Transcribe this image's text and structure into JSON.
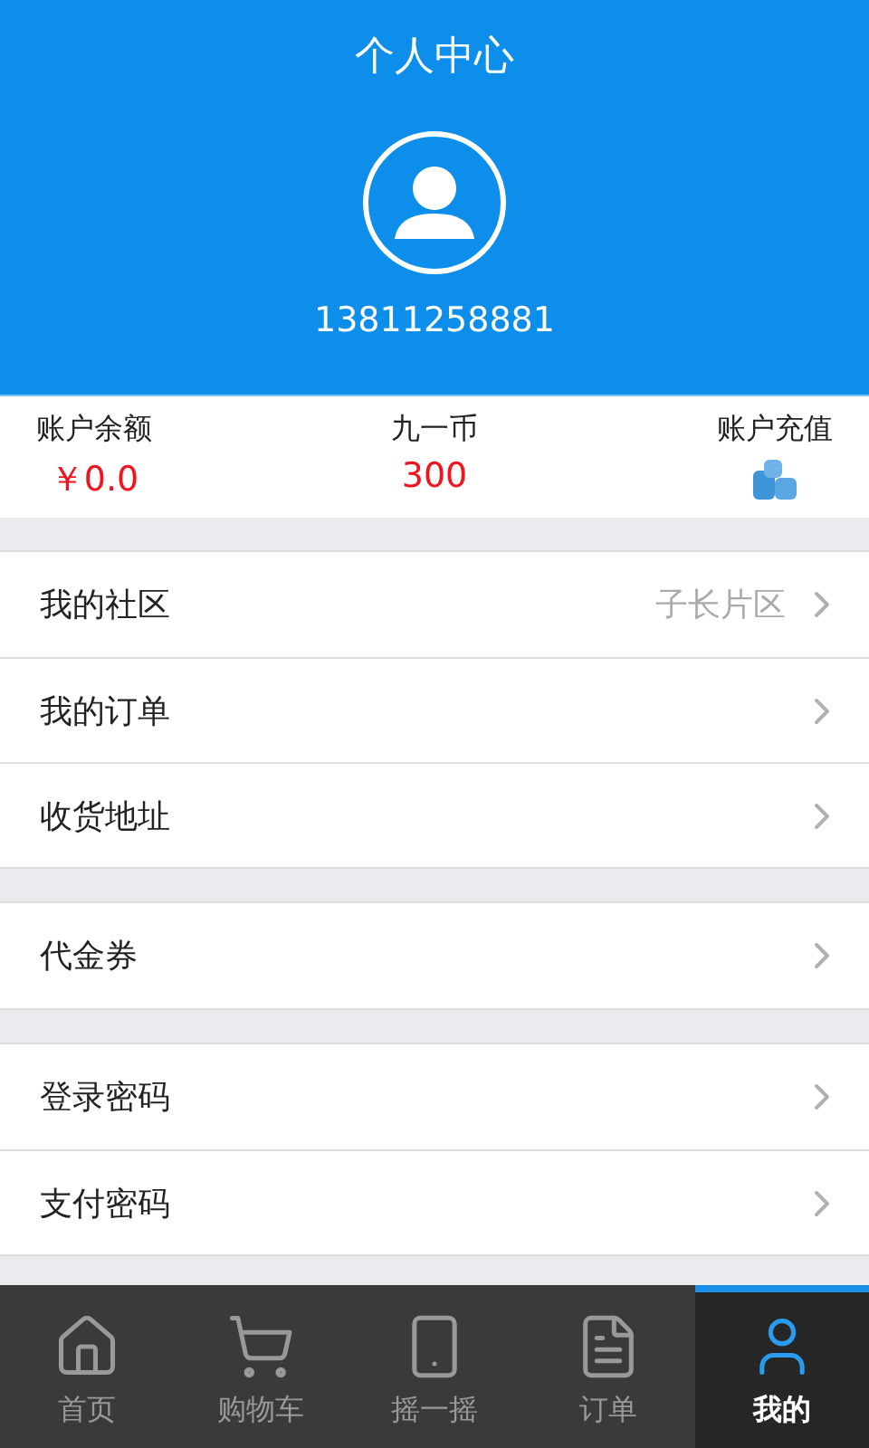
{
  "header": {
    "title": "个人中心",
    "phone": "13811258881"
  },
  "stats": [
    {
      "kind": "value",
      "label": "账户余额",
      "value": "￥0.0"
    },
    {
      "kind": "value",
      "label": "九一币",
      "value": "300"
    },
    {
      "kind": "action",
      "label": "账户充值"
    }
  ],
  "groups": [
    [
      {
        "label": "我的社区",
        "detail": "子长片区"
      },
      {
        "label": "我的订单"
      },
      {
        "label": "收货地址"
      }
    ],
    [
      {
        "label": "代金券"
      }
    ],
    [
      {
        "label": "登录密码"
      },
      {
        "label": "支付密码"
      }
    ]
  ],
  "tabs": [
    {
      "kind": "home",
      "label": "首页",
      "selected": false
    },
    {
      "kind": "cart",
      "label": "购物车",
      "selected": false
    },
    {
      "kind": "shake",
      "label": "摇一摇",
      "selected": false
    },
    {
      "kind": "orders",
      "label": "订单",
      "selected": false
    },
    {
      "kind": "me",
      "label": "我的",
      "selected": true
    }
  ]
}
